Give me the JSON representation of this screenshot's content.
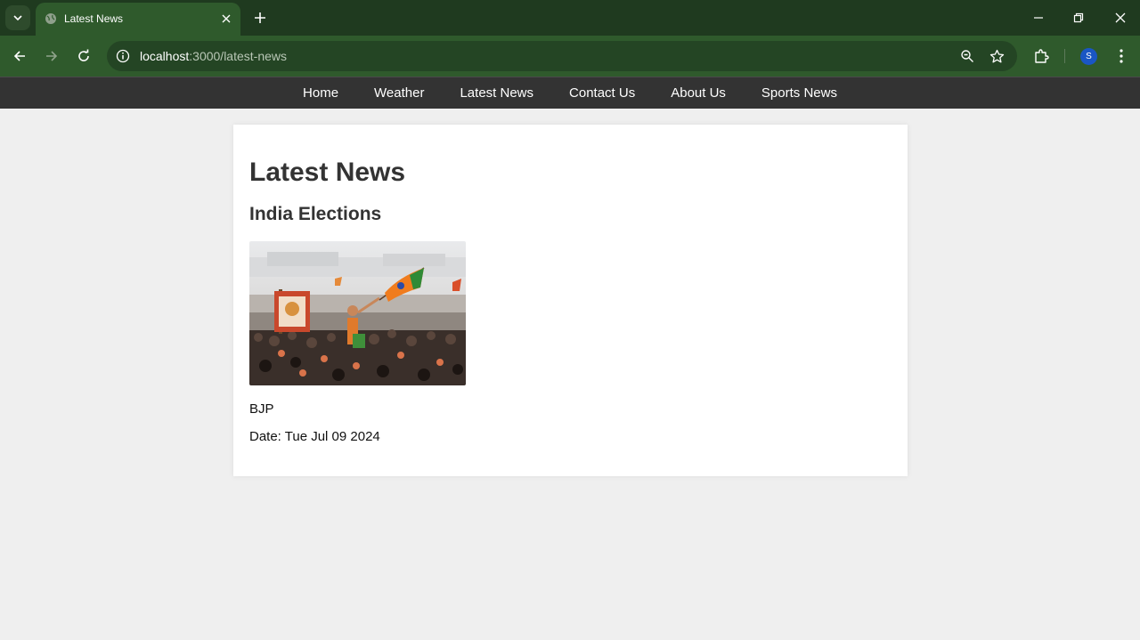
{
  "browser": {
    "tab": {
      "title": "Latest News"
    },
    "address": {
      "host": "localhost",
      "path": ":3000/latest-news"
    },
    "accent": "#2f5a2c",
    "profile_initial": "S"
  },
  "sitenav": {
    "items": [
      "Home",
      "Weather",
      "Latest News",
      "Contact Us",
      "About Us",
      "Sports News"
    ]
  },
  "main": {
    "title": "Latest News",
    "article": {
      "title": "India Elections",
      "description": "BJP",
      "date": "Date: Tue Jul 09 2024"
    }
  }
}
